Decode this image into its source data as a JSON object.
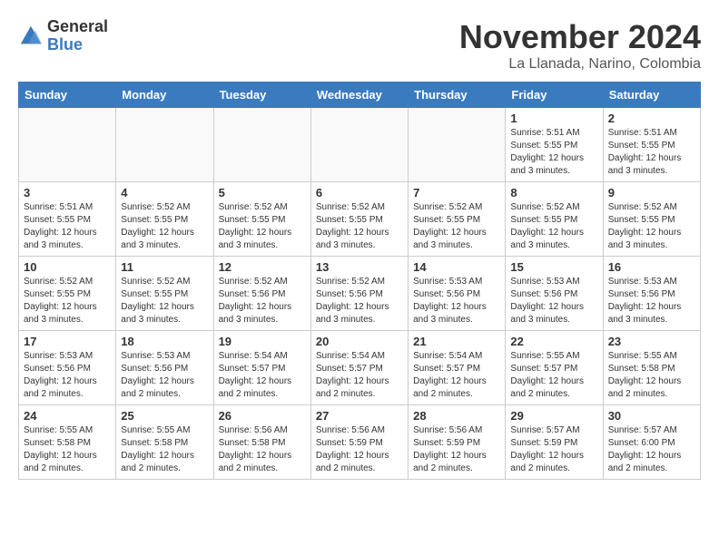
{
  "header": {
    "logo_general": "General",
    "logo_blue": "Blue",
    "month_title": "November 2024",
    "location": "La Llanada, Narino, Colombia"
  },
  "weekdays": [
    "Sunday",
    "Monday",
    "Tuesday",
    "Wednesday",
    "Thursday",
    "Friday",
    "Saturday"
  ],
  "weeks": [
    [
      {
        "day": "",
        "info": ""
      },
      {
        "day": "",
        "info": ""
      },
      {
        "day": "",
        "info": ""
      },
      {
        "day": "",
        "info": ""
      },
      {
        "day": "",
        "info": ""
      },
      {
        "day": "1",
        "info": "Sunrise: 5:51 AM\nSunset: 5:55 PM\nDaylight: 12 hours\nand 3 minutes."
      },
      {
        "day": "2",
        "info": "Sunrise: 5:51 AM\nSunset: 5:55 PM\nDaylight: 12 hours\nand 3 minutes."
      }
    ],
    [
      {
        "day": "3",
        "info": "Sunrise: 5:51 AM\nSunset: 5:55 PM\nDaylight: 12 hours\nand 3 minutes."
      },
      {
        "day": "4",
        "info": "Sunrise: 5:52 AM\nSunset: 5:55 PM\nDaylight: 12 hours\nand 3 minutes."
      },
      {
        "day": "5",
        "info": "Sunrise: 5:52 AM\nSunset: 5:55 PM\nDaylight: 12 hours\nand 3 minutes."
      },
      {
        "day": "6",
        "info": "Sunrise: 5:52 AM\nSunset: 5:55 PM\nDaylight: 12 hours\nand 3 minutes."
      },
      {
        "day": "7",
        "info": "Sunrise: 5:52 AM\nSunset: 5:55 PM\nDaylight: 12 hours\nand 3 minutes."
      },
      {
        "day": "8",
        "info": "Sunrise: 5:52 AM\nSunset: 5:55 PM\nDaylight: 12 hours\nand 3 minutes."
      },
      {
        "day": "9",
        "info": "Sunrise: 5:52 AM\nSunset: 5:55 PM\nDaylight: 12 hours\nand 3 minutes."
      }
    ],
    [
      {
        "day": "10",
        "info": "Sunrise: 5:52 AM\nSunset: 5:55 PM\nDaylight: 12 hours\nand 3 minutes."
      },
      {
        "day": "11",
        "info": "Sunrise: 5:52 AM\nSunset: 5:55 PM\nDaylight: 12 hours\nand 3 minutes."
      },
      {
        "day": "12",
        "info": "Sunrise: 5:52 AM\nSunset: 5:56 PM\nDaylight: 12 hours\nand 3 minutes."
      },
      {
        "day": "13",
        "info": "Sunrise: 5:52 AM\nSunset: 5:56 PM\nDaylight: 12 hours\nand 3 minutes."
      },
      {
        "day": "14",
        "info": "Sunrise: 5:53 AM\nSunset: 5:56 PM\nDaylight: 12 hours\nand 3 minutes."
      },
      {
        "day": "15",
        "info": "Sunrise: 5:53 AM\nSunset: 5:56 PM\nDaylight: 12 hours\nand 3 minutes."
      },
      {
        "day": "16",
        "info": "Sunrise: 5:53 AM\nSunset: 5:56 PM\nDaylight: 12 hours\nand 3 minutes."
      }
    ],
    [
      {
        "day": "17",
        "info": "Sunrise: 5:53 AM\nSunset: 5:56 PM\nDaylight: 12 hours\nand 2 minutes."
      },
      {
        "day": "18",
        "info": "Sunrise: 5:53 AM\nSunset: 5:56 PM\nDaylight: 12 hours\nand 2 minutes."
      },
      {
        "day": "19",
        "info": "Sunrise: 5:54 AM\nSunset: 5:57 PM\nDaylight: 12 hours\nand 2 minutes."
      },
      {
        "day": "20",
        "info": "Sunrise: 5:54 AM\nSunset: 5:57 PM\nDaylight: 12 hours\nand 2 minutes."
      },
      {
        "day": "21",
        "info": "Sunrise: 5:54 AM\nSunset: 5:57 PM\nDaylight: 12 hours\nand 2 minutes."
      },
      {
        "day": "22",
        "info": "Sunrise: 5:55 AM\nSunset: 5:57 PM\nDaylight: 12 hours\nand 2 minutes."
      },
      {
        "day": "23",
        "info": "Sunrise: 5:55 AM\nSunset: 5:58 PM\nDaylight: 12 hours\nand 2 minutes."
      }
    ],
    [
      {
        "day": "24",
        "info": "Sunrise: 5:55 AM\nSunset: 5:58 PM\nDaylight: 12 hours\nand 2 minutes."
      },
      {
        "day": "25",
        "info": "Sunrise: 5:55 AM\nSunset: 5:58 PM\nDaylight: 12 hours\nand 2 minutes."
      },
      {
        "day": "26",
        "info": "Sunrise: 5:56 AM\nSunset: 5:58 PM\nDaylight: 12 hours\nand 2 minutes."
      },
      {
        "day": "27",
        "info": "Sunrise: 5:56 AM\nSunset: 5:59 PM\nDaylight: 12 hours\nand 2 minutes."
      },
      {
        "day": "28",
        "info": "Sunrise: 5:56 AM\nSunset: 5:59 PM\nDaylight: 12 hours\nand 2 minutes."
      },
      {
        "day": "29",
        "info": "Sunrise: 5:57 AM\nSunset: 5:59 PM\nDaylight: 12 hours\nand 2 minutes."
      },
      {
        "day": "30",
        "info": "Sunrise: 5:57 AM\nSunset: 6:00 PM\nDaylight: 12 hours\nand 2 minutes."
      }
    ]
  ]
}
